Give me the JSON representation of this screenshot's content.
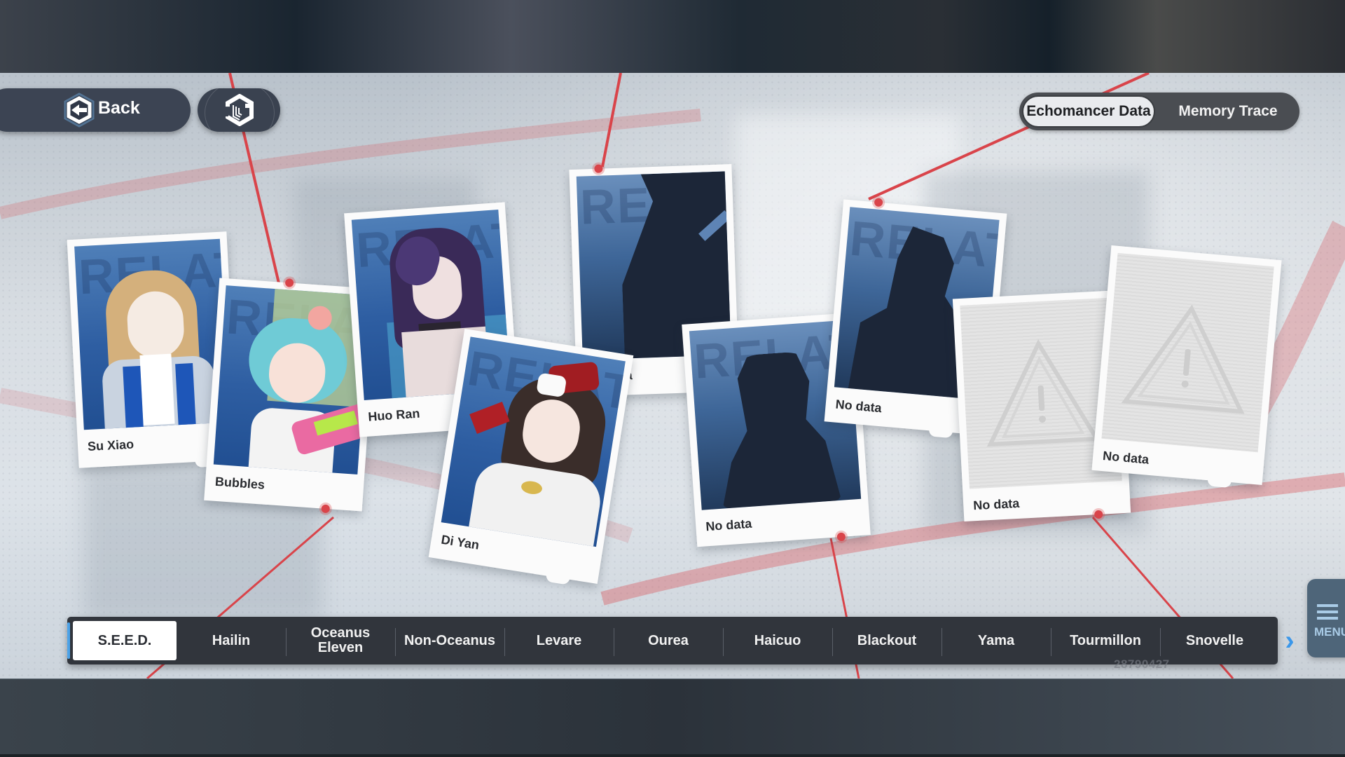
{
  "header": {
    "back_label": "Back",
    "back_icon": "hex-arrow-back-icon",
    "archive_icon": "hex-archive-icon"
  },
  "mode_toggle": {
    "options": [
      {
        "label": "Echomancer Data",
        "active": true
      },
      {
        "label": "Memory Trace",
        "active": false
      }
    ]
  },
  "cards": [
    {
      "name": "Su Xiao",
      "status": "unlocked"
    },
    {
      "name": "Bubbles",
      "status": "unlocked"
    },
    {
      "name": "Huo Ran",
      "status": "unlocked"
    },
    {
      "name": "Di Yan",
      "status": "unlocked"
    },
    {
      "name": "No data",
      "status": "silhouette"
    },
    {
      "name": "No data",
      "status": "silhouette"
    },
    {
      "name": "No data",
      "status": "silhouette"
    },
    {
      "name": "No data",
      "status": "locked"
    },
    {
      "name": "No data",
      "status": "locked"
    }
  ],
  "card_watermark": "RELATIO",
  "factions": {
    "active": "S.E.E.D.",
    "tabs": [
      "S.E.E.D.",
      "Hailin",
      "Oceanus Eleven",
      "Non-Oceanus",
      "Levare",
      "Ourea",
      "Haicuo",
      "Blackout",
      "Yama",
      "Tourmillon",
      "Snovelle"
    ]
  },
  "next_icon": "chevron-right-icon",
  "menu": {
    "label": "MENU",
    "icon": "hamburger-icon"
  },
  "uid": "28790427",
  "colors": {
    "string_red": "#d9444a",
    "accent_blue": "#3a97ea",
    "bar_bg": "#31353c",
    "card_blue": "#2e5ea2"
  }
}
